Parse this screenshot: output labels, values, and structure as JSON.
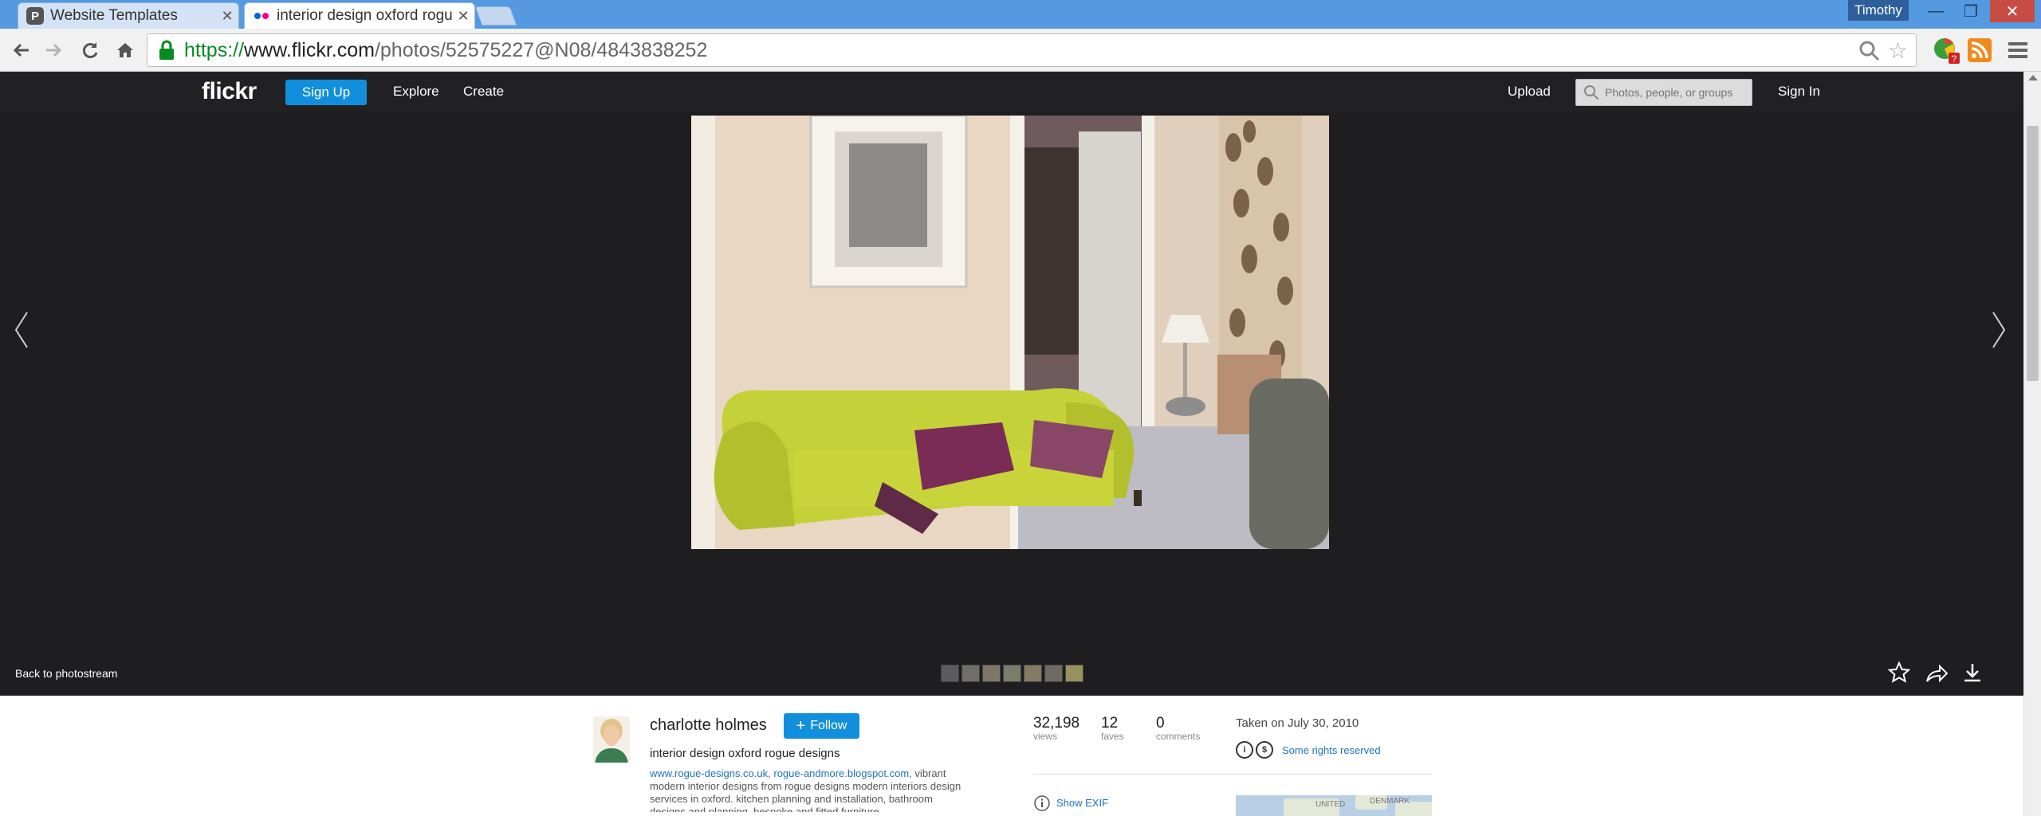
{
  "browser": {
    "tabs": [
      {
        "title": "Website Templates",
        "favicon": "P",
        "active": false
      },
      {
        "title": "interior design oxford rogue designs",
        "active": true
      }
    ],
    "user": "Timothy",
    "url": {
      "scheme": "https://",
      "host": "www.flickr.com",
      "path": "/photos/52575227@N08/4843838252"
    }
  },
  "flickr": {
    "logo": "flickr",
    "nav": {
      "signup": "Sign Up",
      "explore": "Explore",
      "create": "Create",
      "upload": "Upload",
      "signin": "Sign In"
    },
    "search_placeholder": "Photos, people, or groups"
  },
  "viewer": {
    "back_link": "Back to photostream",
    "filmstrip_count": 7
  },
  "photo_info": {
    "owner": "charlotte holmes",
    "follow_label": "Follow",
    "title": "interior design oxford rogue designs",
    "description": {
      "link1": "www.rogue-designs.co.uk",
      "sep": ", ",
      "link2": "rogue-andmore.blogspot.com",
      "text": ", vibrant modern interior designs from rogue designs modern interiors design services in oxford. kitchen planning and installation, bathroom designs and planning, bespoke and fitted furniture..."
    },
    "stats": {
      "views": "32,198",
      "views_label": "views",
      "faves": "12",
      "faves_label": "faves",
      "comments": "0",
      "comments_label": "comments"
    },
    "taken": "Taken on July 30, 2010",
    "license": "Some rights reserved",
    "exif": "Show EXIF",
    "map_labels": [
      "UNITED",
      "DENMARK"
    ]
  },
  "colors": {
    "flickr_blue": "#128fdc",
    "link": "#1f72c1",
    "dark_bg": "#1e1e20",
    "sofa": "#c9d43a"
  }
}
